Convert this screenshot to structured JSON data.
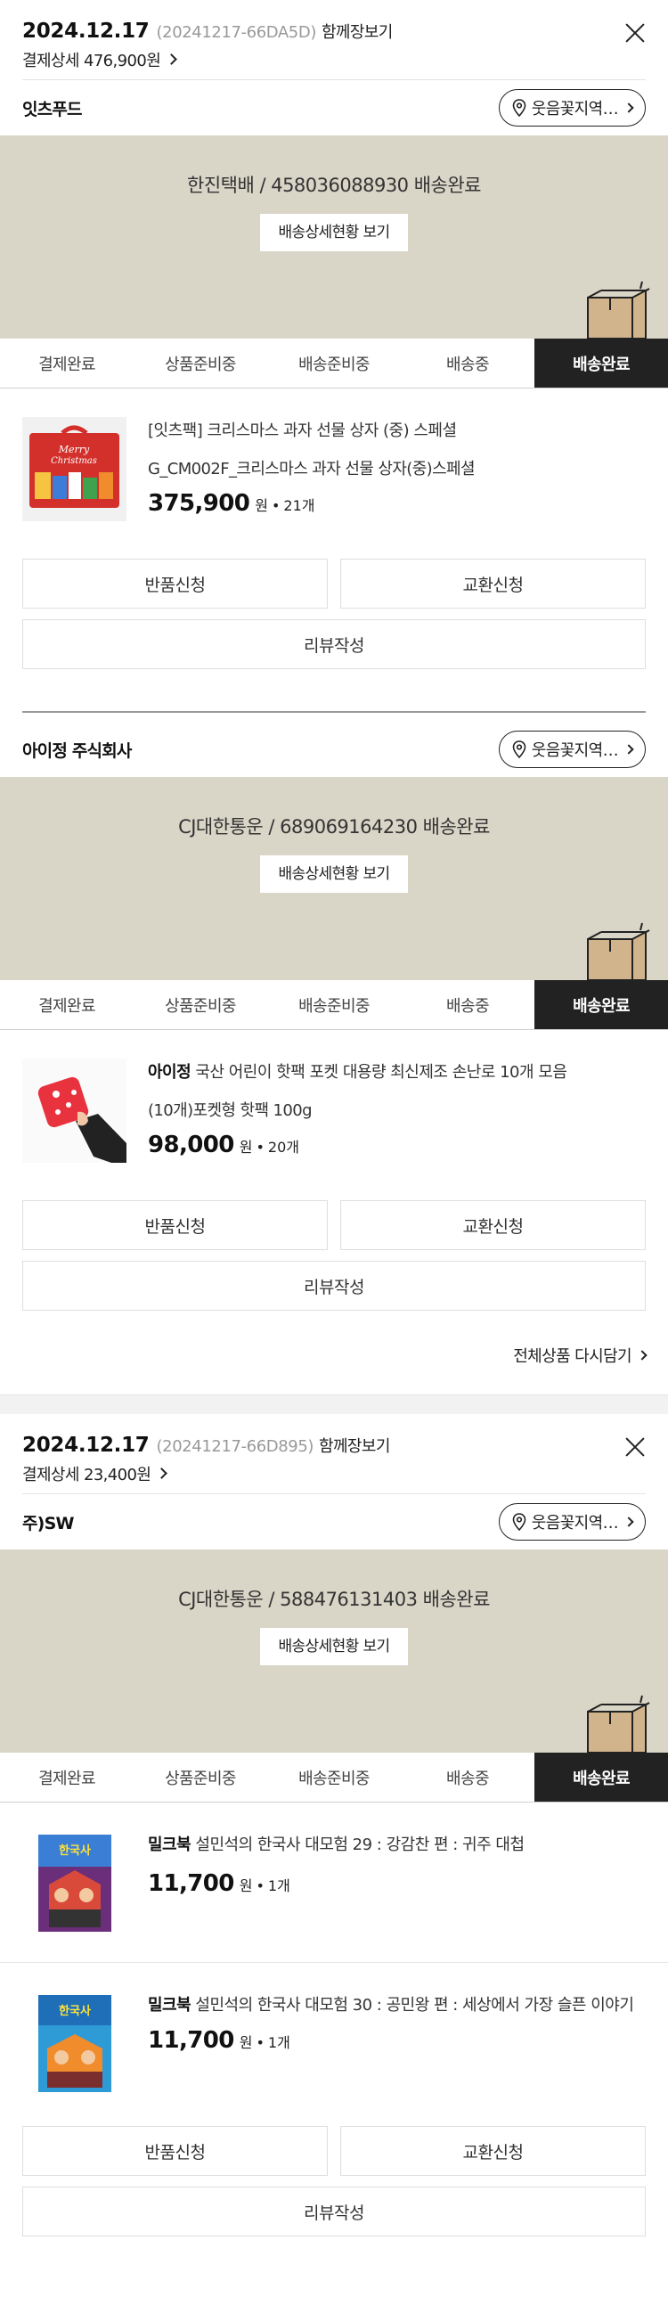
{
  "orders": [
    {
      "date": "2024.12.17",
      "order_id": "(20241217-66DA5D)",
      "view_together": "함께장보기",
      "payment_detail": "결제상세 476,900원"
    },
    {
      "date": "2024.12.17",
      "order_id": "(20241217-66D895)",
      "view_together": "함께장보기",
      "payment_detail": "결제상세 23,400원"
    }
  ],
  "steps": [
    "결제완료",
    "상품준비중",
    "배송준비중",
    "배송중",
    "배송완료"
  ],
  "shipment_button": "배송상세현황 보기",
  "area_label": "웃음꽃지역…",
  "action_labels": {
    "return": "반품신청",
    "exchange": "교환신청",
    "review": "리뷰작성"
  },
  "reorder_label": "전체상품 다시담기",
  "sellers": [
    {
      "name": "잇츠푸드",
      "shipment": "한진택배 / 458036088930 배송완료",
      "items": [
        {
          "brand": "",
          "name": "[잇츠팩] 크리스마스 과자 선물 상자 (중) 스페셜",
          "option": "G_CM002F_크리스마스 과자 선물 상자(중)스페셜",
          "price": "375,900",
          "won": "원",
          "qty": "21개"
        }
      ]
    },
    {
      "name": "아이정 주식회사",
      "shipment": "CJ대한통운 / 689069164230 배송완료",
      "items": [
        {
          "brand": "아이정",
          "name": " 국산 어린이 핫팩 포켓 대용량 최신제조 손난로 10개 모음",
          "option": "(10개)포켓형 핫팩 100g",
          "price": "98,000",
          "won": "원",
          "qty": "20개"
        }
      ]
    },
    {
      "name": "주)SW",
      "shipment": "CJ대한통운 / 588476131403 배송완료",
      "items": [
        {
          "brand": "밀크북",
          "name": " 설민석의 한국사 대모험 29 : 강감찬 편 : 귀주 대첩",
          "option": "",
          "price": "11,700",
          "won": "원",
          "qty": "1개"
        },
        {
          "brand": "밀크북",
          "name": " 설민석의 한국사 대모험 30 : 공민왕 편 : 세상에서 가장 슬픈 이야기",
          "option": "",
          "price": "11,700",
          "won": "원",
          "qty": "1개"
        }
      ]
    }
  ]
}
